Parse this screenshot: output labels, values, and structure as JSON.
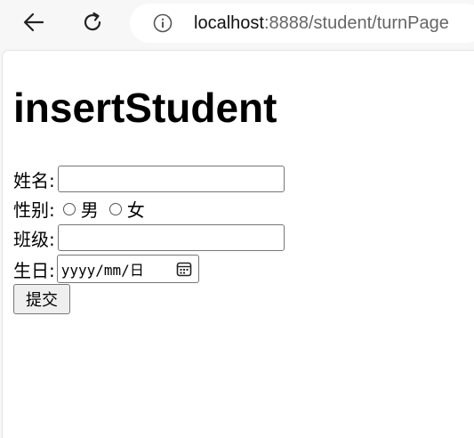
{
  "browser": {
    "url_host": "localhost",
    "url_path": ":8888/student/turnPage",
    "back_icon": "arrow-left-icon",
    "refresh_icon": "refresh-icon",
    "info_icon": "info-icon"
  },
  "page": {
    "title": "insertStudent"
  },
  "form": {
    "name_label": "姓名:",
    "name_value": "",
    "gender_label": "性别:",
    "gender_options": [
      "男",
      "女"
    ],
    "class_label": "班级:",
    "class_value": "",
    "birthday_label": "生日:",
    "birthday_placeholder": "yyyy/mm/日",
    "submit_label": "提交"
  }
}
